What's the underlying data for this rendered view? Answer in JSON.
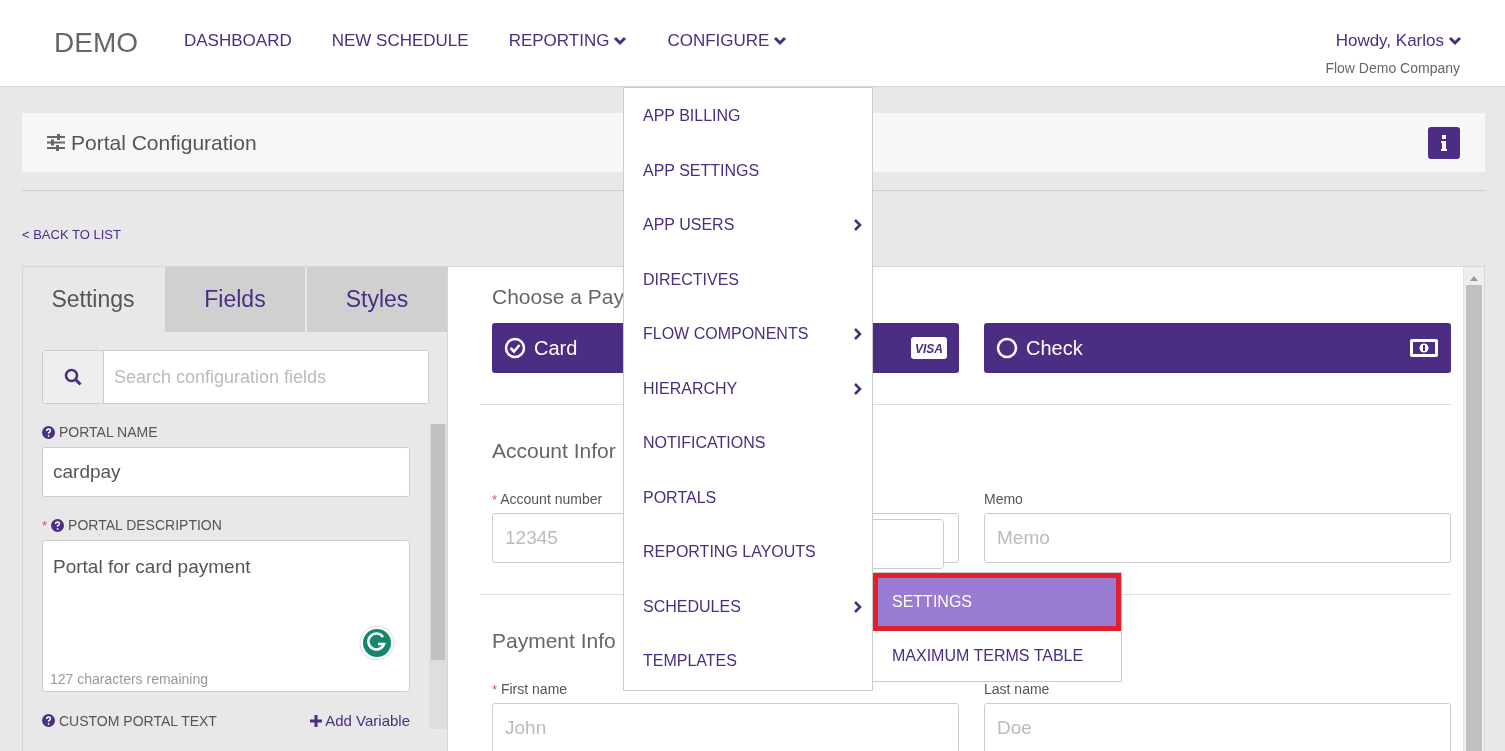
{
  "nav": {
    "brand": "DEMO",
    "items": [
      {
        "label": "DASHBOARD",
        "kind": "link"
      },
      {
        "label": "NEW SCHEDULE",
        "kind": "link"
      },
      {
        "label": "REPORTING",
        "kind": "dropdown"
      },
      {
        "label": "CONFIGURE",
        "kind": "dropdown"
      }
    ],
    "user": {
      "greeting": "Howdy, Karlos",
      "company": "Flow Demo Company"
    }
  },
  "page_title": "Portal Configuration",
  "back_link": "< BACK TO LIST",
  "tabs": [
    {
      "label": "Settings",
      "selected": true
    },
    {
      "label": "Fields",
      "selected": false
    },
    {
      "label": "Styles",
      "selected": false
    }
  ],
  "search": {
    "placeholder": "Search configuration fields"
  },
  "settings": [
    {
      "kind": "input",
      "label": "PORTAL NAME",
      "value": "cardpay"
    },
    {
      "kind": "textarea",
      "required_mark": "*",
      "label": "PORTAL DESCRIPTION",
      "value": "Portal for card payment",
      "note": "127 characters remaining"
    },
    {
      "kind": "heading",
      "label": "CUSTOM PORTAL TEXT",
      "action": "Add Variable"
    }
  ],
  "preview": {
    "method_heading": "Choose a Pay",
    "methods": [
      {
        "label": "Card",
        "selected": true,
        "kind": "card",
        "icon_text": "VISA"
      },
      {
        "label": "Check",
        "selected": false,
        "kind": "check"
      }
    ],
    "sections": [
      {
        "heading": "Account Infor",
        "fields": [
          {
            "label": "Account number",
            "required_mark": "*",
            "placeholder": "12345"
          },
          {
            "label": "Memo",
            "placeholder": "Memo"
          }
        ]
      },
      {
        "heading": "Payment Info",
        "fields": [
          {
            "label": "First name",
            "required_mark": "*",
            "placeholder": "John"
          },
          {
            "label": "Last name",
            "placeholder": "Doe"
          }
        ]
      }
    ]
  },
  "menu": {
    "items": [
      {
        "label": "APP BILLING",
        "kind": "link"
      },
      {
        "label": "APP SETTINGS",
        "kind": "link"
      },
      {
        "label": "APP USERS",
        "kind": "submenu"
      },
      {
        "label": "DIRECTIVES",
        "kind": "link"
      },
      {
        "label": "FLOW COMPONENTS",
        "kind": "submenu"
      },
      {
        "label": "HIERARCHY",
        "kind": "submenu"
      },
      {
        "label": "NOTIFICATIONS",
        "kind": "link"
      },
      {
        "label": "PORTALS",
        "kind": "link"
      },
      {
        "label": "REPORTING LAYOUTS",
        "kind": "link"
      },
      {
        "label": "SCHEDULES",
        "kind": "submenu"
      },
      {
        "label": "TEMPLATES",
        "kind": "link"
      }
    ],
    "submenu": [
      {
        "label": "SETTINGS",
        "selected": true
      },
      {
        "label": "MAXIMUM TERMS TABLE",
        "selected": false
      }
    ]
  }
}
